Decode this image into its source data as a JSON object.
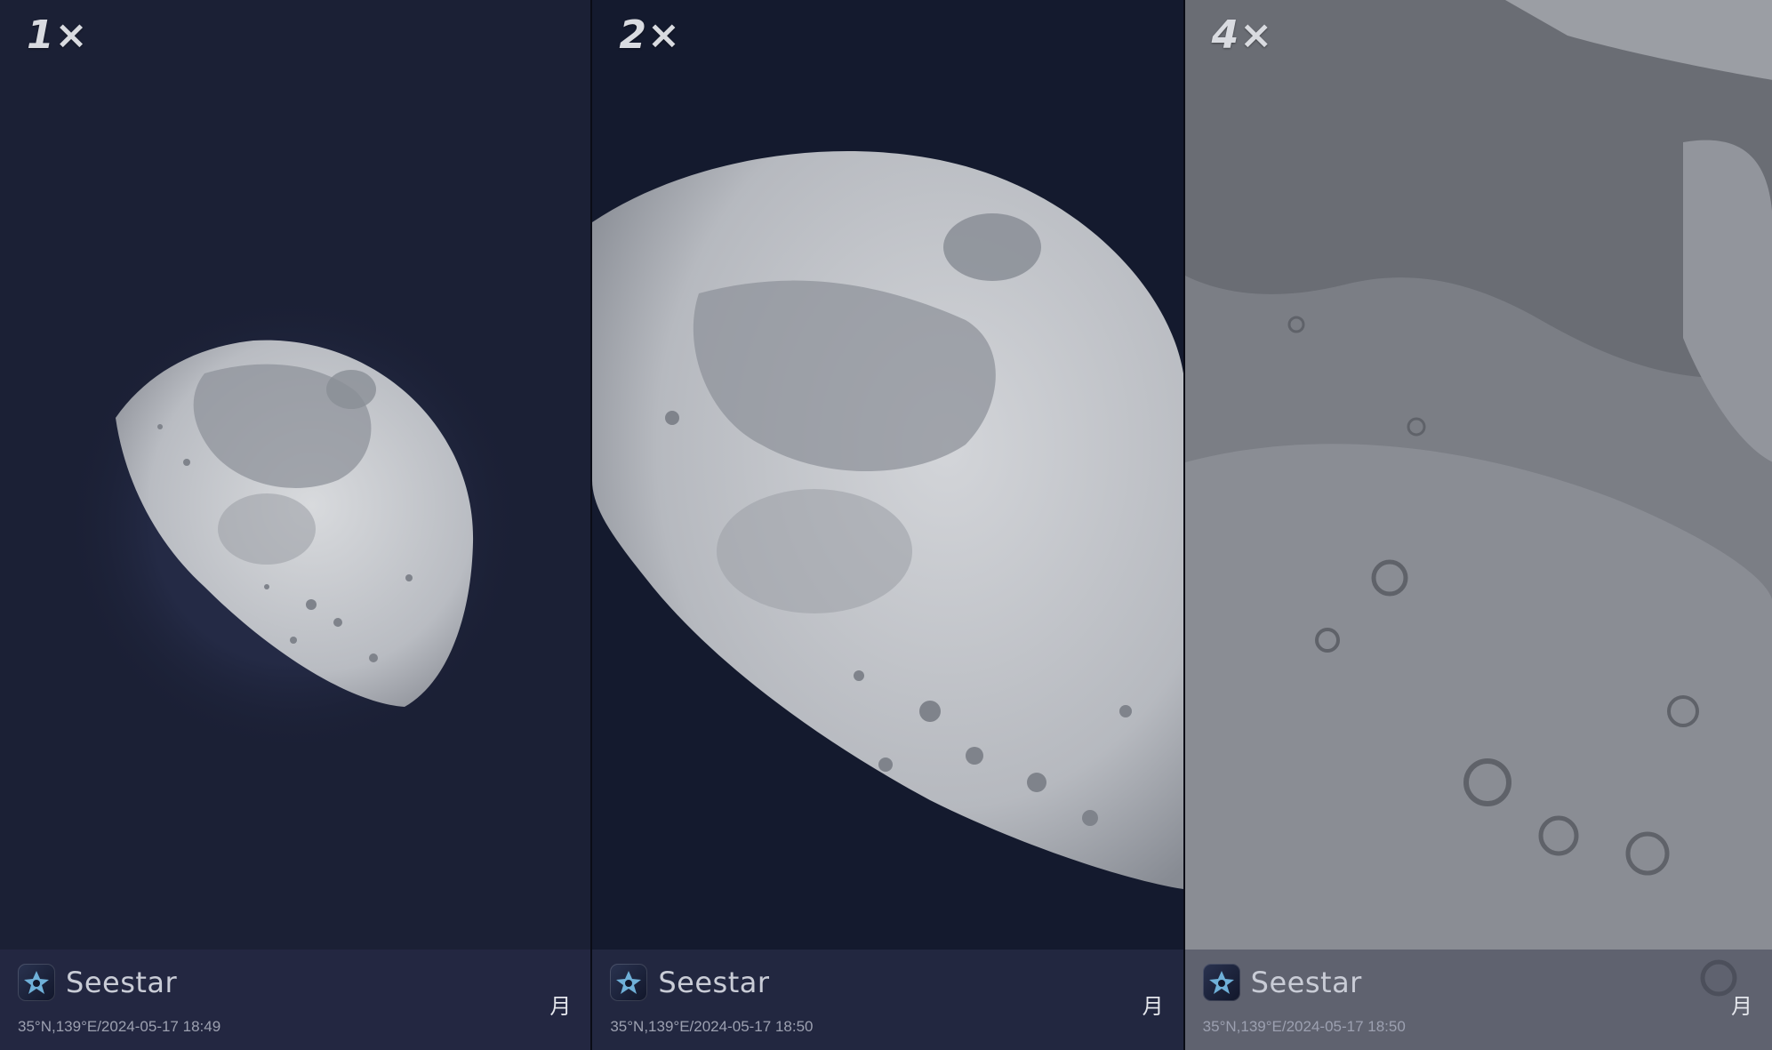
{
  "panels": [
    {
      "zoom": "1×",
      "brand": "Seestar",
      "meta": "35°N,139°E/2024-05-17 18:49",
      "target": "月"
    },
    {
      "zoom": "2×",
      "brand": "Seestar",
      "meta": "35°N,139°E/2024-05-17 18:50",
      "target": "月"
    },
    {
      "zoom": "4×",
      "brand": "Seestar",
      "meta": "35°N,139°E/2024-05-17 18:50",
      "target": "月"
    }
  ],
  "colors": {
    "sky_1x": "#1b2035",
    "sky_2x": "#141a2e",
    "moon_light": "#c8cace",
    "moon_mare": "#8f939b",
    "footer": "#242842"
  },
  "icons": [
    "seestar-logo-icon"
  ]
}
